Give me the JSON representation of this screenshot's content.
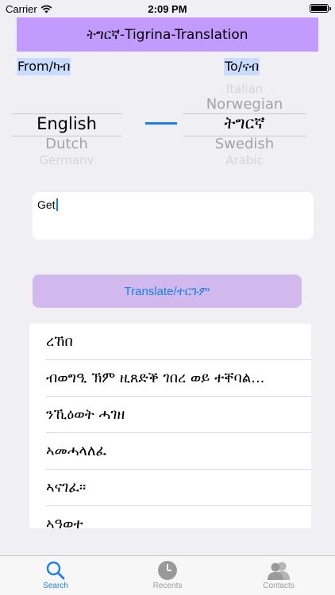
{
  "status": {
    "carrier": "Carrier",
    "time": "2:09 PM"
  },
  "header": {
    "title": "ትግርኛ-Tigrina-Translation"
  },
  "from_label": "From/ካብ",
  "to_label": "To/ናብ",
  "from_picker": {
    "selected": "English",
    "below": "Dutch",
    "below2": "Germany"
  },
  "to_picker": {
    "above2": "Italian",
    "above": "Norwegian",
    "selected": "ትግርኛ",
    "below": "Swedish",
    "below2": "Arabic"
  },
  "input": {
    "value": "Get"
  },
  "translate_button": "Translate/ተርጉም",
  "results": [
    "ረኸበ",
    "ብወግዒ ኽም ዚጸድቕ ገበረ ወይ ተቐባል...",
    "ንኺዕወት ሓገዘ",
    "ኣመሓላለፈ",
    "ኣናገፈ።",
    "ኣዓወተ"
  ],
  "tabs": [
    {
      "label": "Search",
      "icon": "search-icon"
    },
    {
      "label": "Recents",
      "icon": "clock-icon"
    },
    {
      "label": "Contacts",
      "icon": "contacts-icon"
    }
  ],
  "colors": {
    "accent": "#1a7fe8",
    "title_bg": "#c39bff",
    "button_bg": "#d1b9ed",
    "label_bg": "#c9dcff"
  }
}
